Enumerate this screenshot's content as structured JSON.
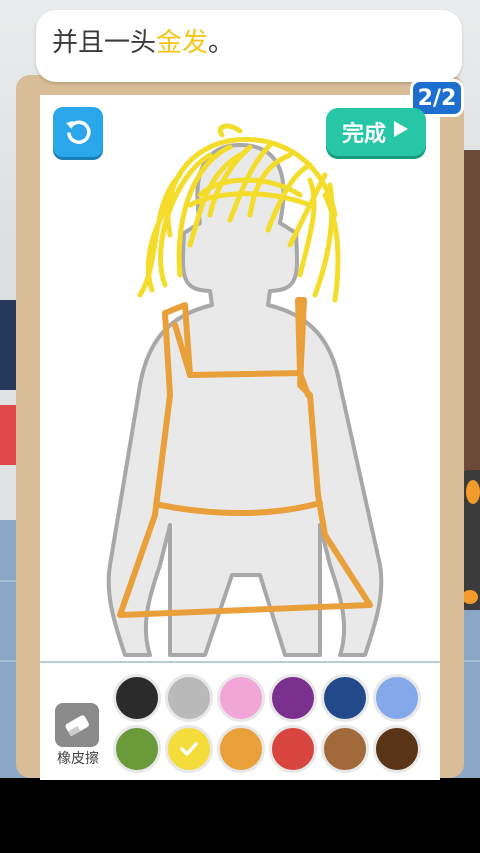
{
  "speech": {
    "prefix": "并且一头",
    "highlight": "金发",
    "suffix": "。"
  },
  "page_indicator": "2/2",
  "done_button": {
    "label": "完成"
  },
  "eraser_label": "橡皮擦",
  "colors": {
    "highlight_text": "#f5c518",
    "hair_stroke": "#f4dc2a",
    "dress_stroke": "#e9a03a",
    "accent_blue": "#2aa6ea",
    "accent_teal": "#26c6a6"
  },
  "palette": {
    "selected": "yellow",
    "swatches": [
      {
        "name": "black",
        "color": "#2b2b2b"
      },
      {
        "name": "light-gray",
        "color": "#b9b9b9"
      },
      {
        "name": "pink",
        "color": "#f2a6d8"
      },
      {
        "name": "purple",
        "color": "#7b2f8f"
      },
      {
        "name": "navy",
        "color": "#224a8a"
      },
      {
        "name": "light-blue",
        "color": "#85a8ea"
      },
      {
        "name": "green",
        "color": "#6a9a3a"
      },
      {
        "name": "yellow",
        "color": "#f4dc3a"
      },
      {
        "name": "orange",
        "color": "#e9a03a"
      },
      {
        "name": "red",
        "color": "#d8453f"
      },
      {
        "name": "brown",
        "color": "#a06a3a"
      },
      {
        "name": "dark-brown",
        "color": "#5a3416"
      }
    ]
  }
}
